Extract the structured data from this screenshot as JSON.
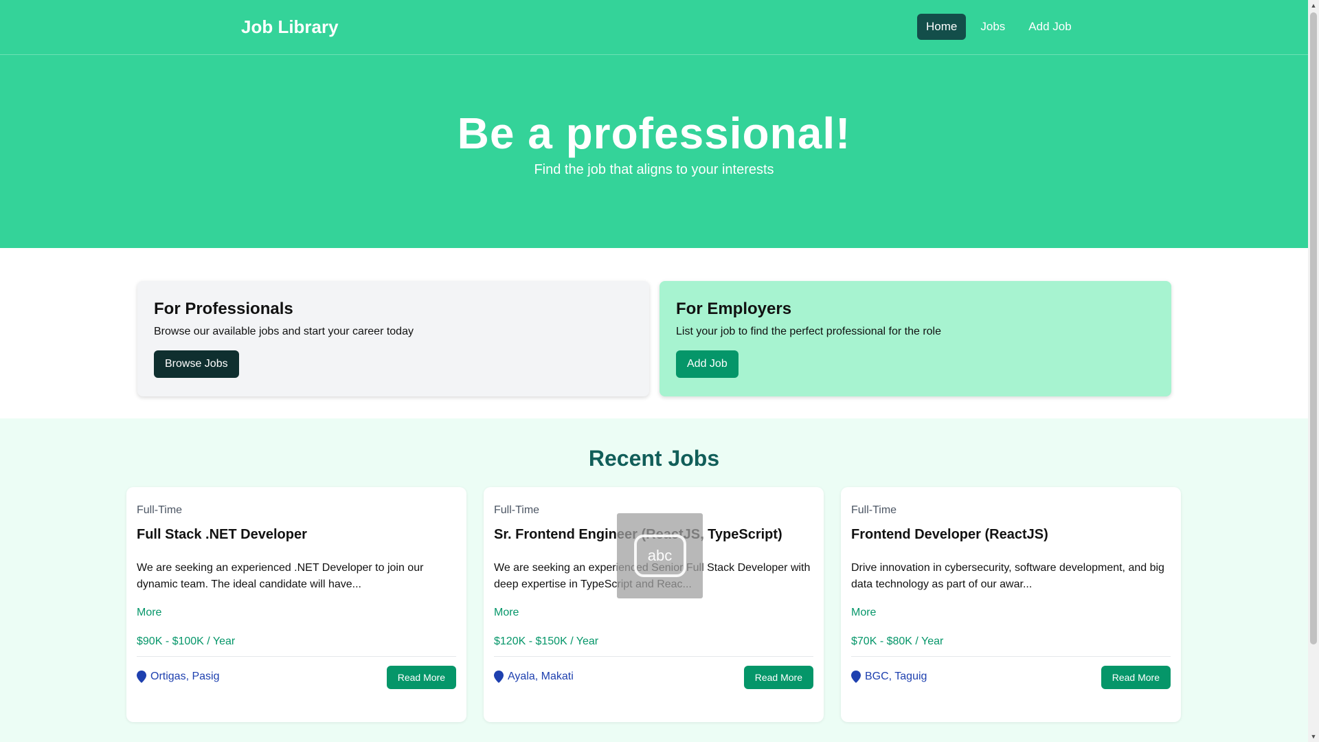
{
  "nav": {
    "brand": "Job Library",
    "links": [
      {
        "label": "Home"
      },
      {
        "label": "Jobs"
      },
      {
        "label": "Add Job"
      }
    ]
  },
  "hero": {
    "title": "Be a professional!",
    "subtitle": "Find the job that aligns to your interests"
  },
  "professionals": {
    "title": "For Professionals",
    "text": "Browse our available jobs and start your career today",
    "button": "Browse Jobs"
  },
  "employers": {
    "title": "For Employers",
    "text": "List your job to find the perfect professional for the role",
    "button": "Add Job"
  },
  "recent": {
    "title": "Recent Jobs",
    "jobs": [
      {
        "type": "Full-Time",
        "title": "Full Stack .NET Developer",
        "description": "We are seeking an experienced .NET Developer to join our dynamic team. The ideal candidate will have...",
        "more": "More",
        "salary": "$90K - $100K / Year",
        "location": "Ortigas, Pasig",
        "button": "Read More"
      },
      {
        "type": "Full-Time",
        "title": "Sr. Frontend Engineer (ReactJS, TypeScript)",
        "description": "We are seeking an experienced Senior Full Stack Developer with deep expertise in TypeScript and Reac...",
        "more": "More",
        "salary": "$120K - $150K / Year",
        "location": "Ayala, Makati",
        "button": "Read More"
      },
      {
        "type": "Full-Time",
        "title": "Frontend Developer (ReactJS)",
        "description": "Drive innovation in cybersecurity, software development, and big data technology as part of our awar...",
        "more": "More",
        "salary": "$70K - $80K / Year",
        "location": "BGC, Taguig",
        "button": "Read More"
      }
    ]
  },
  "overlay": {
    "label": "abc"
  },
  "colors": {
    "primary": "#34d399",
    "dark": "#134e4a",
    "accent": "#059669",
    "employer_bg": "#a7f3d0",
    "recent_bg": "#ecfdf5",
    "location": "#1e40af"
  }
}
